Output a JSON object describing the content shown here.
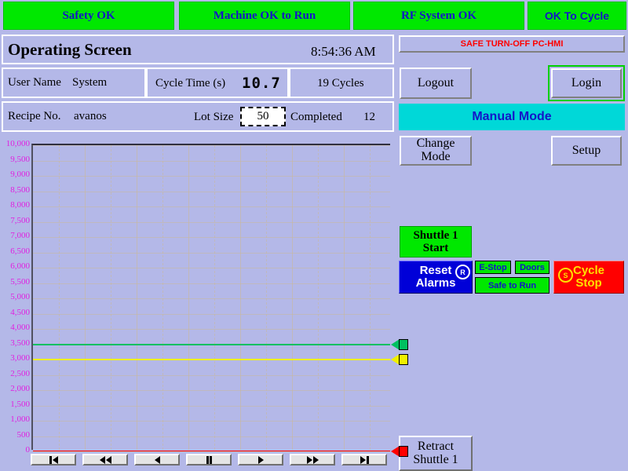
{
  "statusbar": {
    "items": [
      {
        "label": "Safety OK",
        "font": "serif"
      },
      {
        "label": "Machine OK to Run",
        "font": "serif"
      },
      {
        "label": "RF System OK",
        "font": "serif"
      },
      {
        "label": "OK To Cycle",
        "font": "sans"
      }
    ],
    "color_bg": "#00e800",
    "color_text": "#1414c8"
  },
  "header": {
    "title": "Operating Screen",
    "time": "8:54:36 AM"
  },
  "info": {
    "user_label": "User Name",
    "user_value": "System",
    "cycle_time_label": "Cycle Time (s)",
    "cycle_time_value": "10.7",
    "cycles_value": "19 Cycles",
    "recipe_label": "Recipe No.",
    "recipe_value": "avanos",
    "lot_size_label": "Lot Size",
    "lot_size_value": "50",
    "completed_label": "Completed",
    "completed_value": "12"
  },
  "right_panel": {
    "safe_turnoff": "SAFE TURN-OFF PC-HMI",
    "logout": "Logout",
    "login": "Login",
    "mode": "Manual Mode",
    "mode_color": "#00d8d8",
    "change_mode": "Change Mode",
    "setup": "Setup"
  },
  "controls": {
    "shuttle_start": "Shuttle 1\nStart",
    "shuttle_start_line1": "Shuttle 1",
    "shuttle_start_line2": "Start",
    "reset_alarms_line1": "Reset",
    "reset_alarms_line2": "Alarms",
    "reset_badge": "R",
    "estop": "E-Stop",
    "doors": "Doors",
    "safe_to_run": "Safe to Run",
    "cycle_stop_line1": "Cycle",
    "cycle_stop_line2": "Stop",
    "cycle_stop_badge": "S",
    "retract_line1": "Retract",
    "retract_line2": "Shuttle 1"
  },
  "transport": {
    "buttons": [
      {
        "name": "skip-to-start",
        "glyph": "bar-left"
      },
      {
        "name": "rewind",
        "glyph": "left-left"
      },
      {
        "name": "step-back",
        "glyph": "left"
      },
      {
        "name": "pause",
        "glyph": "pause"
      },
      {
        "name": "play",
        "glyph": "right"
      },
      {
        "name": "fast-forward",
        "glyph": "right-right"
      },
      {
        "name": "skip-to-end",
        "glyph": "right-bar"
      }
    ]
  },
  "chart_data": {
    "type": "line",
    "title": "",
    "xlabel": "",
    "ylabel": "",
    "ylim": [
      0,
      10000
    ],
    "ytick_step": 500,
    "grid": true,
    "legend": "none",
    "ticks": [
      "10,000",
      "9,500",
      "9,000",
      "8,500",
      "8,000",
      "7,500",
      "7,000",
      "6,500",
      "6,000",
      "5,500",
      "5,000",
      "4,500",
      "4,000",
      "3,500",
      "3,000",
      "2,500",
      "2,000",
      "1,500",
      "1,000",
      "500",
      "0"
    ],
    "series": [
      {
        "name": "setpoint-high",
        "color": "#00c060",
        "value": 3500,
        "style": "horizontal-line",
        "marker": "left-triangle"
      },
      {
        "name": "setpoint-low",
        "color": "#f0f000",
        "value": 3000,
        "style": "horizontal-line",
        "marker": "left-triangle"
      },
      {
        "name": "baseline",
        "color": "#ff0000",
        "value": 0,
        "style": "horizontal-line",
        "marker": "left-triangle"
      }
    ],
    "grid_color": "#c9b89a",
    "tick_color": "#e020e0"
  }
}
